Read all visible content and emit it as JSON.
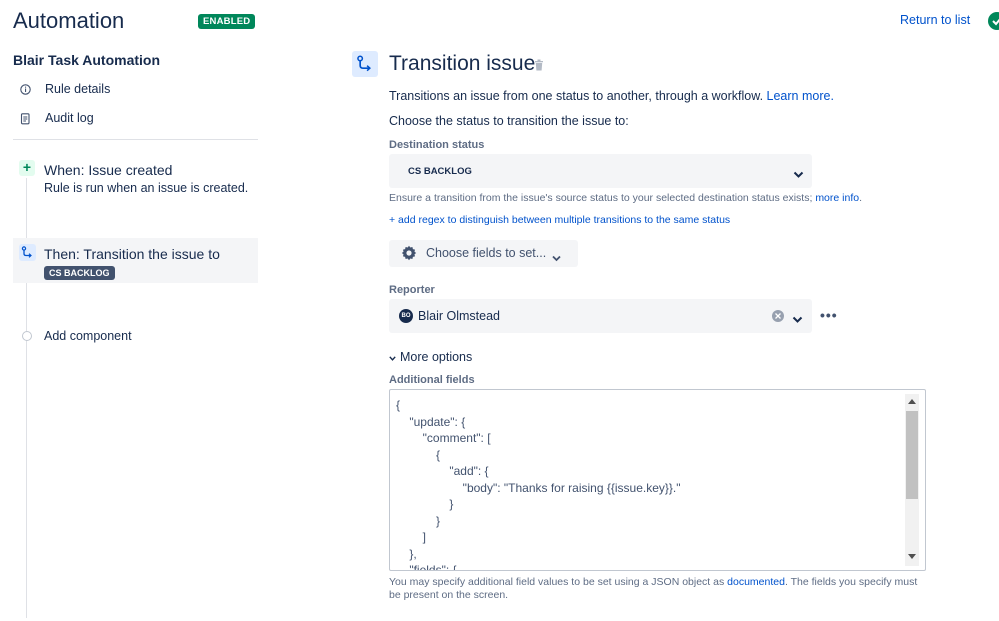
{
  "header": {
    "title": "Automation",
    "status_badge": "ENABLED",
    "return_link": "Return to list"
  },
  "sidebar": {
    "rule_name": "Blair Task Automation",
    "links": [
      {
        "label": "Rule details",
        "icon": "info-icon"
      },
      {
        "label": "Audit log",
        "icon": "document-icon"
      }
    ],
    "trigger": {
      "title": "When: Issue created",
      "description": "Rule is run when an issue is created."
    },
    "action": {
      "title": "Then: Transition the issue to",
      "badge": "CS BACKLOG"
    },
    "add_component": "Add component"
  },
  "main": {
    "title": "Transition issue",
    "description": "Transitions an issue from one status to another, through a workflow.",
    "learn_more": "Learn more.",
    "choose_prompt": "Choose the status to transition the issue to:",
    "destination_label": "Destination status",
    "destination_value": "CS BACKLOG",
    "transition_hint": "Ensure a transition from the issue's source status to your selected destination status exists;",
    "more_info": "more info",
    "regex_link": "+ add regex to distinguish between multiple transitions to the same status",
    "choose_fields": "Choose fields to set...",
    "reporter_label": "Reporter",
    "reporter_initials": "BO",
    "reporter_value": "Blair Olmstead",
    "more_options": "More options",
    "additional_fields_label": "Additional fields",
    "additional_fields_value": "{\n    \"update\": {\n        \"comment\": [\n            {\n                \"add\": {\n                    \"body\": \"Thanks for raising {{issue.key}}.\"\n                }\n            }\n        ]\n    },\n    \"fields\": {",
    "footer_hint_pre": "You may specify additional field values to be set using a JSON object as",
    "documented": "documented",
    "footer_hint_post": ". The fields you specify must be present on the screen."
  },
  "colors": {
    "accent": "#0052cc",
    "success": "#00875a",
    "badge_dark": "#42526e"
  }
}
